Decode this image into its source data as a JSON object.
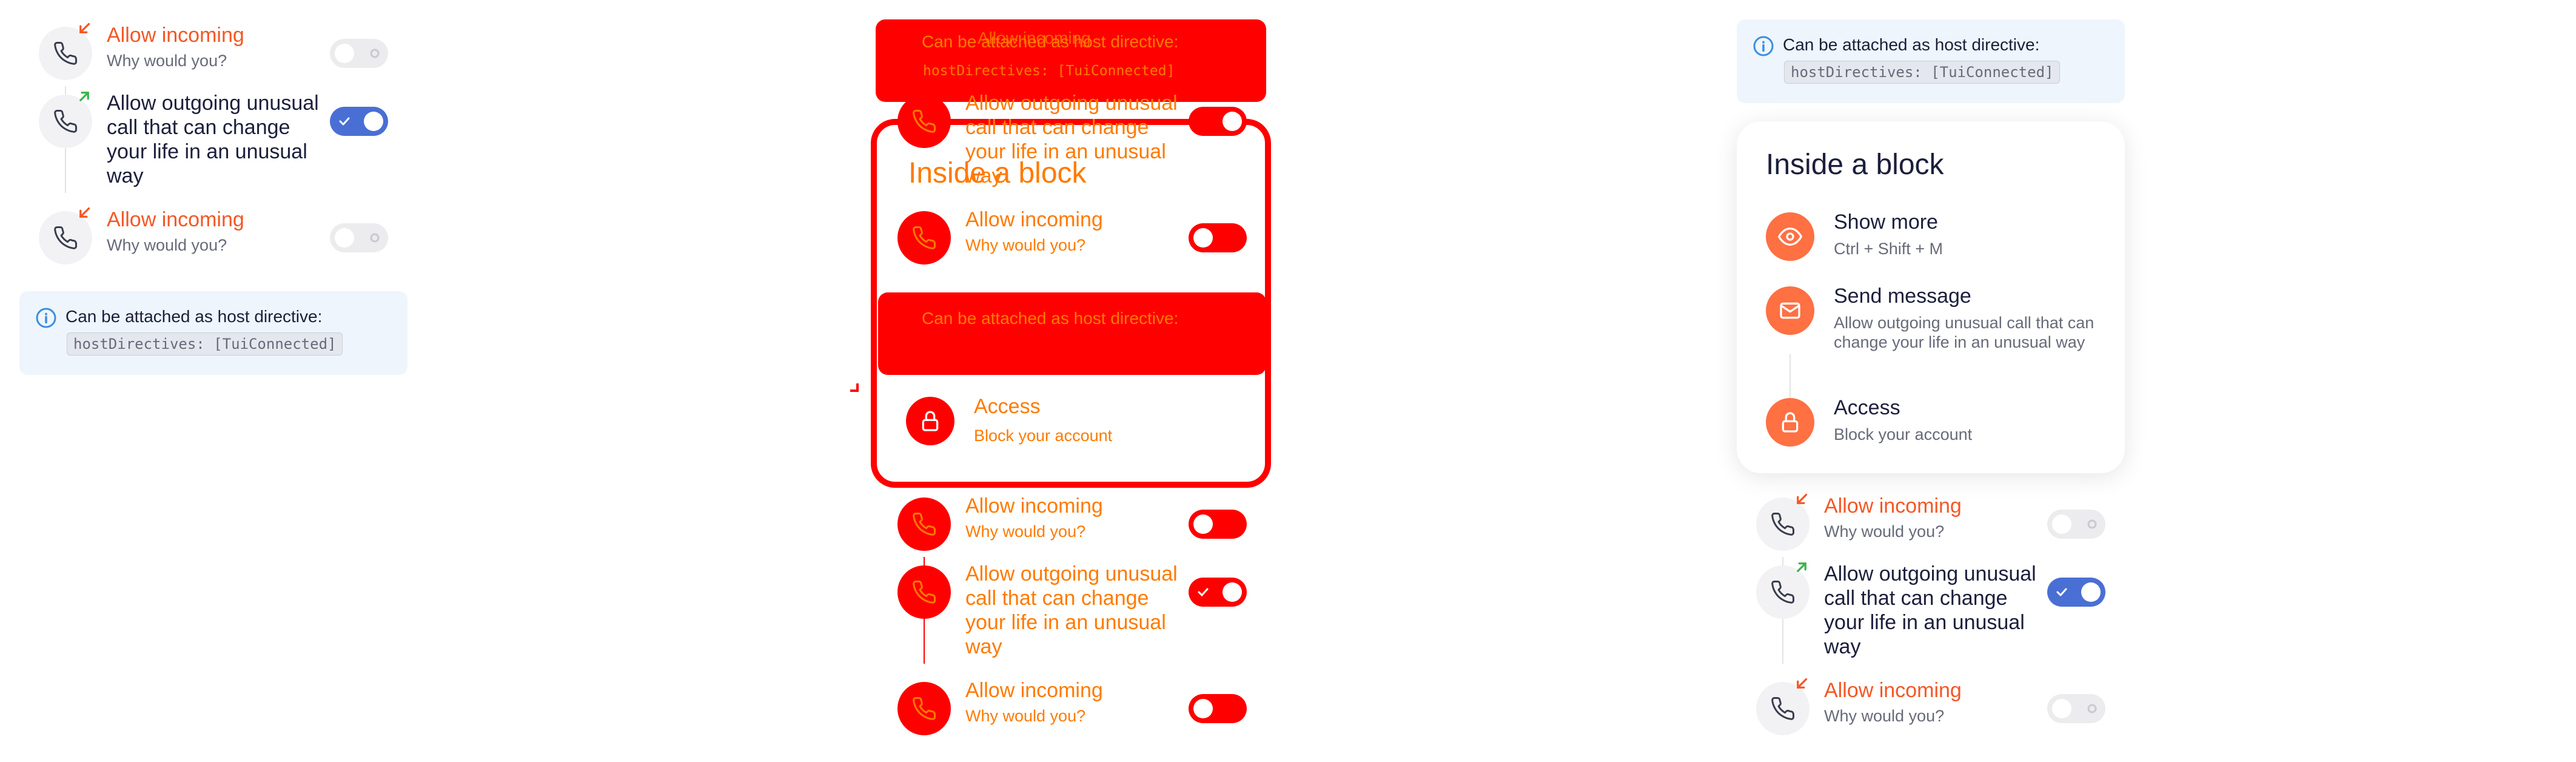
{
  "rows": [
    {
      "title": "Allow incoming",
      "subtitle": "Why would you?",
      "alert": true,
      "badge": "incoming-call-arrow",
      "enabled": false
    },
    {
      "title": "Allow outgoing unusual call that can change your life in an unusual way",
      "subtitle": "",
      "alert": false,
      "badge": "outgoing-call-arrow",
      "enabled": true
    },
    {
      "title": "Allow incoming",
      "subtitle": "Why would you?",
      "alert": true,
      "badge": "incoming-call-arrow",
      "enabled": false
    }
  ],
  "note": {
    "text": "Can be attached as host directive:",
    "code": "hostDirectives: [TuiConnected]"
  },
  "block": {
    "title": "Inside a block",
    "items": [
      {
        "icon": "eye-icon",
        "title": "Show more",
        "subtitle": "Ctrl + Shift + M"
      },
      {
        "icon": "mail-icon",
        "title": "Send message",
        "subtitle": "Allow outgoing unusual call that can change your life in an unusual way"
      },
      {
        "icon": "lock-icon",
        "title": "Access",
        "subtitle": "Block your account"
      }
    ]
  },
  "colors": {
    "alert_text": "#f45725",
    "accent_orange": "#ff7043",
    "toggle_on": "#4a6fd4",
    "note_background": "#eef5fc",
    "overlay_red": "#ff0000",
    "overlay_text": "#ff7a00",
    "incoming_badge": "#f45725",
    "outgoing_badge": "#39b54a"
  }
}
